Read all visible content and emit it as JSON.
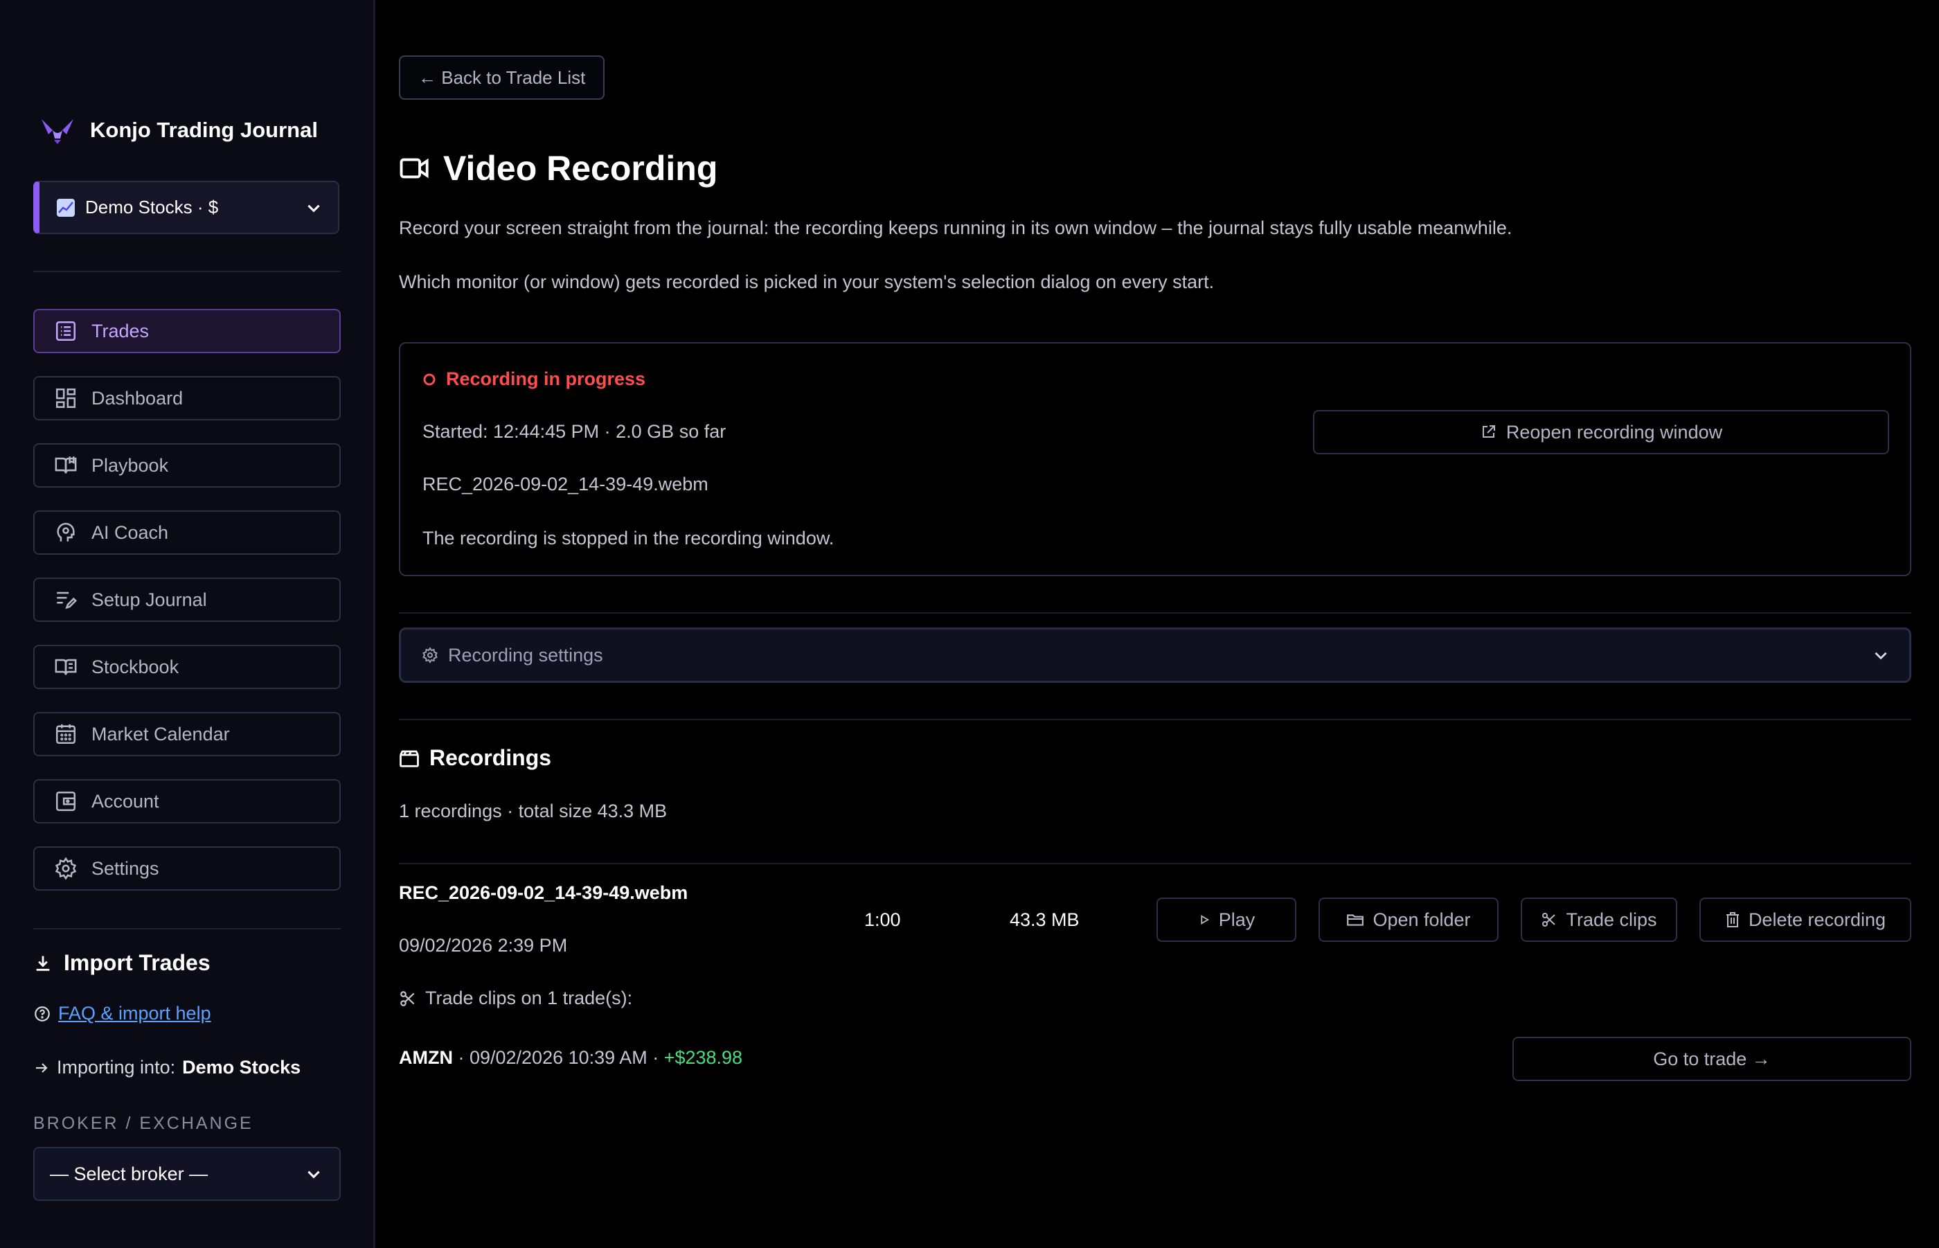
{
  "sidebar": {
    "brand": "Konjo Trading Journal",
    "account": "Demo Stocks · $",
    "nav": [
      {
        "label": "Trades",
        "icon": "list-icon",
        "active": true
      },
      {
        "label": "Dashboard",
        "icon": "dashboard-icon"
      },
      {
        "label": "Playbook",
        "icon": "book-open-icon"
      },
      {
        "label": "AI Coach",
        "icon": "brain-icon"
      },
      {
        "label": "Setup Journal",
        "icon": "pen-lines-icon"
      },
      {
        "label": "Stockbook",
        "icon": "book-icon"
      },
      {
        "label": "Market Calendar",
        "icon": "calendar-icon"
      },
      {
        "label": "Account",
        "icon": "wallet-icon"
      },
      {
        "label": "Settings",
        "icon": "gear-icon"
      }
    ],
    "import_title": "Import Trades",
    "faq_link": "FAQ & import help",
    "importing_label": "Importing into:",
    "importing_target": "Demo Stocks",
    "broker_label": "BROKER / EXCHANGE",
    "broker_select": "— Select broker —"
  },
  "main": {
    "back_button": "← Back to Trade List",
    "title": "Video Recording",
    "desc1": "Record your screen straight from the journal: the recording keeps running in its own window – the journal stays fully usable meanwhile.",
    "desc2": "Which monitor (or window) gets recorded is picked in your system's selection dialog on every start.",
    "recording": {
      "status": "Recording in progress",
      "started": "Started: 12:44:45 PM · 2.0 GB so far",
      "file": "REC_2026-09-02_14-39-49.webm",
      "note": "The recording is stopped in the recording window.",
      "reopen_button": "Reopen recording window"
    },
    "settings_label": "Recording settings",
    "recordings_title": "Recordings",
    "summary": "1 recordings · total size 43.3 MB",
    "items": [
      {
        "name": "REC_2026-09-02_14-39-49.webm",
        "date": "09/02/2026 2:39 PM",
        "duration": "1:00",
        "size": "43.3 MB",
        "play": "Play",
        "open_folder": "Open folder",
        "trade_clips": "Trade clips",
        "delete": "Delete recording",
        "clips_title": "Trade clips on 1 trade(s):",
        "clip": {
          "symbol": "AMZN",
          "datetime": " · 09/02/2026 10:39 AM · ",
          "pnl": "+$238.98",
          "goto": "Go to trade →"
        }
      }
    ]
  },
  "colors": {
    "accent": "#8b5cf6",
    "recording_red": "#ff4d4d",
    "profit_green": "#4ade80",
    "link_blue": "#5aa2ff"
  }
}
